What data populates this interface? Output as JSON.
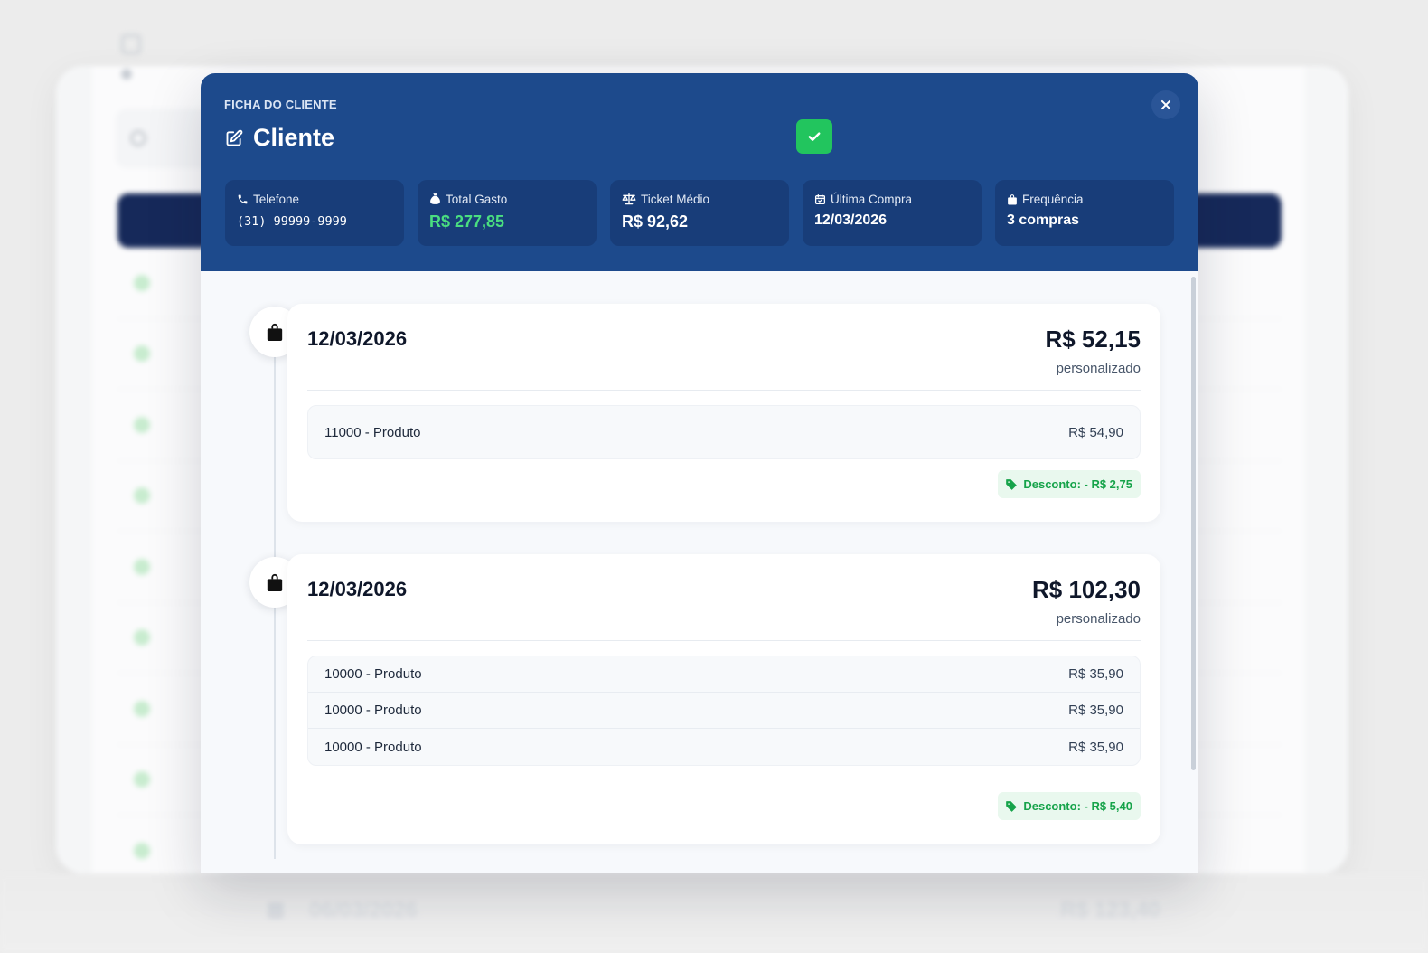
{
  "modal": {
    "eyebrow": "FICHA DO CLIENTE",
    "client_name": "Cliente",
    "stats": [
      {
        "label": "Telefone",
        "value": "(31) 99999-9999",
        "icon": "phone-icon"
      },
      {
        "label": "Total Gasto",
        "value": "R$ 277,85",
        "icon": "money-bag-icon"
      },
      {
        "label": "Ticket Médio",
        "value": "R$ 92,62",
        "icon": "scale-icon"
      },
      {
        "label": "Última Compra",
        "value": "12/03/2026",
        "icon": "calendar-check-icon"
      },
      {
        "label": "Frequência",
        "value": "3 compras",
        "icon": "shopping-bag-icon"
      }
    ]
  },
  "orders": [
    {
      "date": "12/03/2026",
      "total": "R$ 52,15",
      "type": "personalizado",
      "items": [
        {
          "name": "11000 - Produto",
          "price": "R$ 54,90"
        }
      ],
      "discount": "Desconto: - R$ 2,75"
    },
    {
      "date": "12/03/2026",
      "total": "R$ 102,30",
      "type": "personalizado",
      "items": [
        {
          "name": "10000 - Produto",
          "price": "R$ 35,90"
        },
        {
          "name": "10000 - Produto",
          "price": "R$ 35,90"
        },
        {
          "name": "10000 - Produto",
          "price": "R$ 35,90"
        }
      ],
      "discount": "Desconto: - R$ 5,40"
    },
    {
      "date": "06/03/2026",
      "total": "R$ 123,40"
    }
  ],
  "colors": {
    "header_bg": "#1d4a8c",
    "stat_bg": "#183d79",
    "accent_green": "#22c55e",
    "discount_green": "#16a34a",
    "total_gasto_green": "#4ade80"
  }
}
